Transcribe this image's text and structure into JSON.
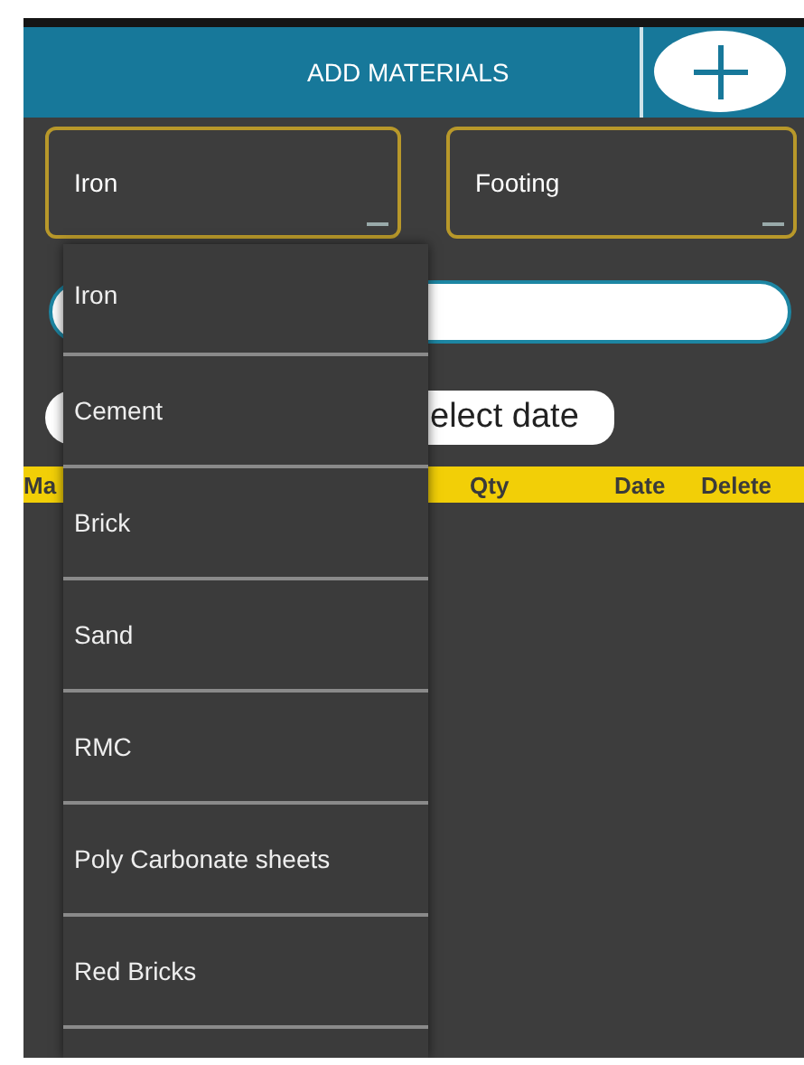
{
  "header": {
    "title": "ADD MATERIALS"
  },
  "dropdowns": [
    {
      "value": "Iron"
    },
    {
      "value": "Footing"
    }
  ],
  "date_button": {
    "label": "elect date"
  },
  "table": {
    "columns": [
      "Ma",
      "Qty",
      "Date",
      "Delete"
    ]
  },
  "menu": {
    "options": [
      "Iron",
      "Cement",
      "Brick",
      "Sand",
      "RMC",
      "Poly Carbonate sheets",
      "Red Bricks"
    ]
  }
}
